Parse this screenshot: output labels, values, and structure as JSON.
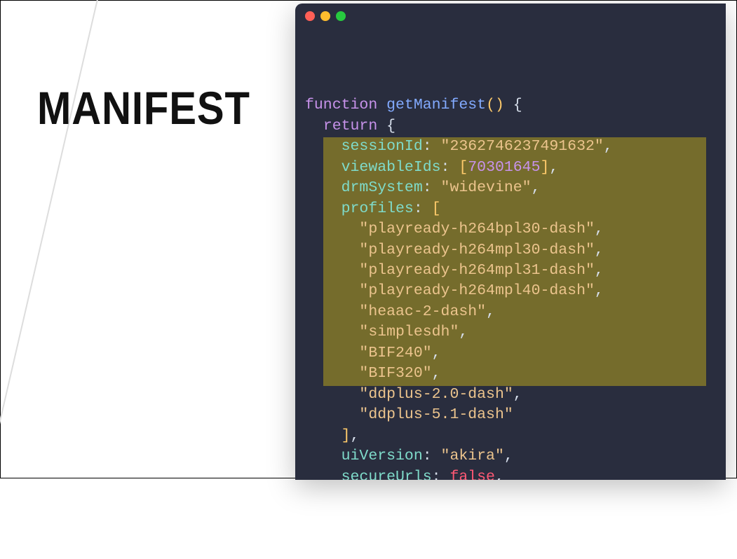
{
  "title": "MANIFEST",
  "code": {
    "functionKeyword": "function",
    "functionName": "getManifest",
    "returnKeyword": "return",
    "fields": {
      "sessionId": {
        "key": "sessionId",
        "value": "2362746237491632"
      },
      "viewableIds": {
        "key": "viewableIds",
        "value": "70301645"
      },
      "drmSystem": {
        "key": "drmSystem",
        "value": "widevine"
      },
      "profiles": {
        "key": "profiles",
        "items": [
          "playready-h264bpl30-dash",
          "playready-h264mpl30-dash",
          "playready-h264mpl31-dash",
          "playready-h264mpl40-dash",
          "heaac-2-dash",
          "simplesdh",
          "BIF240",
          "BIF320",
          "ddplus-2.0-dash",
          "ddplus-5.1-dash"
        ]
      },
      "uiVersion": {
        "key": "uiVersion",
        "value": "akira"
      },
      "secureUrls": {
        "key": "secureUrls",
        "value": "false"
      }
    }
  }
}
